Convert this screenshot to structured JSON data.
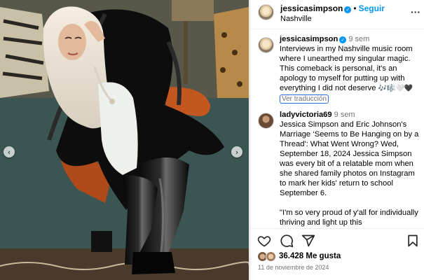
{
  "post": {
    "username": "jessicasimpson",
    "follow_label": "Seguir",
    "location": "Nashville",
    "more_icon": "more-horizontal-icon"
  },
  "caption": {
    "username": "jessicasimpson",
    "time": "9 sem",
    "text": "Interviews in my Nashville music room where I unearthed my singular magic. This comeback is personal, it's an apology to myself for putting up with everything I did not deserve",
    "emojis": "🎶🎼🤍🖤",
    "translate_label": "Ver traducción"
  },
  "comments": [
    {
      "username": "ladyvictoria69",
      "time": "9 sem",
      "text": "Jessica Simpson and Eric Johnson's Marriage ‘Seems to Be Hanging on by a Thread': What Went Wrong? Wed, September 18, 2024 Jessica Simpson was every bit of a relatable mom when she shared family photos on Instagram to mark her kids' return to school September 6.",
      "text2": "\"I'm so very proud of y'all for individually thriving and light up this"
    }
  ],
  "actions": {
    "like_icon": "heart-icon",
    "comment_icon": "comment-icon",
    "share_icon": "share-icon",
    "save_icon": "bookmark-icon"
  },
  "likes": "36.428 Me gusta",
  "date": "11 de noviembre de 2024",
  "colors": {
    "link": "#0095f6",
    "muted": "#737373",
    "border": "#dbdbdb"
  }
}
